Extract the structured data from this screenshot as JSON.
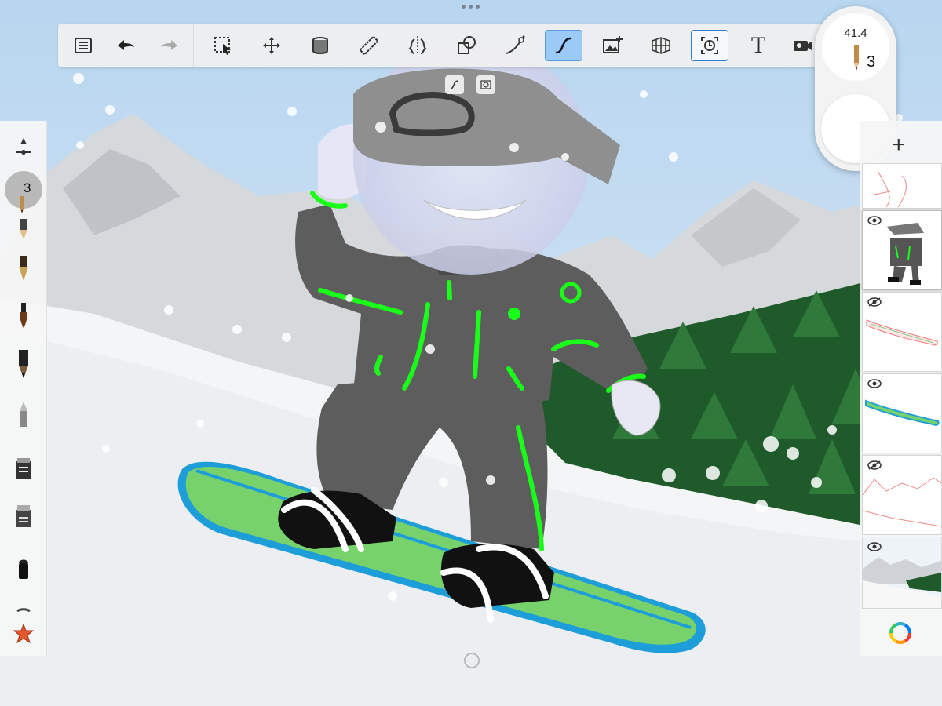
{
  "toolbar": {
    "tools": [
      "menu-icon",
      "undo-icon",
      "redo-icon",
      "selection-icon",
      "transform-icon",
      "fill-icon",
      "ruler-icon",
      "symmetry-icon",
      "shapes-icon",
      "stroke-icon",
      "predictive-stroke-icon",
      "add-image-icon",
      "perspective-icon",
      "time-lapse-icon",
      "text-icon",
      "camera-icon"
    ],
    "text_tool_label": "T",
    "active_tool": "predictive-stroke-icon"
  },
  "brush_puck": {
    "opacity": "41.4",
    "size": "3"
  },
  "brush_palette": {
    "current_size": "3",
    "brushes": [
      "size-adjust-icon",
      "pencil-icon",
      "ink-pen-icon",
      "paintbrush-icon",
      "marker-icon",
      "airbrush-icon",
      "blender-icon",
      "eraser-icon",
      "chisel-icon",
      "star-icon"
    ]
  },
  "layers": {
    "add_label": "+",
    "items": [
      {
        "name": "sketch",
        "visible": true
      },
      {
        "name": "character",
        "visible": true
      },
      {
        "name": "board-outline",
        "visible": false
      },
      {
        "name": "board-color",
        "visible": true
      },
      {
        "name": "mountain-lines",
        "visible": false
      },
      {
        "name": "background",
        "visible": true
      }
    ]
  },
  "colors": {
    "sky": "#cfe3f5",
    "snow": "#f4f5f7",
    "suit": "#5d5d5d",
    "accent": "#1aff1a",
    "board": "#78d26b",
    "board_edge": "#1e9ed9",
    "forest": "#1f5a2a",
    "active_tool": "#9ccaf7"
  }
}
